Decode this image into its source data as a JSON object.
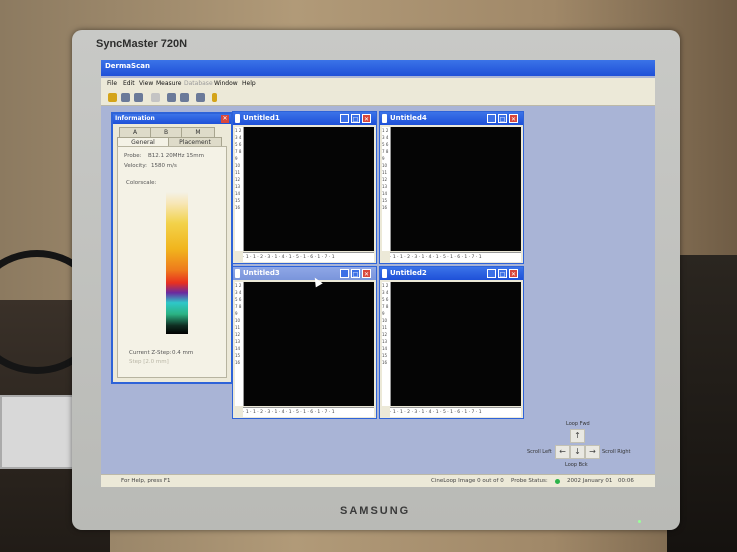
{
  "monitor": {
    "brand_label": "SyncMaster 720N",
    "maker_label": "SAMSUNG"
  },
  "app": {
    "title": "DermaScan"
  },
  "menu": [
    {
      "label": "File",
      "enabled": true
    },
    {
      "label": "Edit",
      "enabled": true
    },
    {
      "label": "View",
      "enabled": true
    },
    {
      "label": "Measure",
      "enabled": true
    },
    {
      "label": "Database",
      "enabled": false
    },
    {
      "label": "Window",
      "enabled": true
    },
    {
      "label": "Help",
      "enabled": true
    }
  ],
  "toolbar_icons": [
    "open-folder-icon",
    "save-icon",
    "print-icon",
    "copy-icon",
    "zoom-in-icon",
    "zoom-out-icon",
    "settings-icon",
    "help-icon"
  ],
  "info_panel": {
    "title": "Information",
    "close_glyph": "✕",
    "tabs_top": [
      "A",
      "B",
      "M"
    ],
    "tabs_bottom": [
      "General",
      "Placement"
    ],
    "probe_label": "Probe:",
    "probe_value": "B12.1 20MHz 15mm",
    "velocity_label": "Velocity:",
    "velocity_value": "1580 m/s",
    "colorscale_label": "Colorscale:",
    "zstep_label": "Current Z-Step:",
    "zstep_value": "0.4 mm",
    "faint_text": "Step [2.0 mm]"
  },
  "windows": [
    {
      "title": "Untitled1",
      "active": true
    },
    {
      "title": "Untitled4",
      "active": true
    },
    {
      "title": "Untitled3",
      "active": false
    },
    {
      "title": "Untitled2",
      "active": true
    }
  ],
  "ruler": {
    "horizontal": "· 1 · 1 · 2 · 3 · 1 · 4 · 1 · 5 · 1 · 6 · 1 · 7 · 1",
    "vertical": "1 2 3 4 5 6 7 8 9 10 11 12 13 14 15 16"
  },
  "scroll_pad": {
    "loop_fwd": "Loop Fwd",
    "loop_bck": "Loop Bck",
    "scroll_left": "Scroll Left",
    "scroll_right": "Scroll Right",
    "up": "↑",
    "left": "←",
    "down": "↓",
    "right": "→"
  },
  "status": {
    "help": "For Help, press F1",
    "cineloop": "CineLoop Image 0 out of 0",
    "probe_status": "Probe Status:",
    "date": "2002 January 01",
    "time": "00:06"
  },
  "colors": {
    "title_blue": "#1e50d8",
    "desktop": "#a9b4d6",
    "close_red": "#d8473b"
  }
}
